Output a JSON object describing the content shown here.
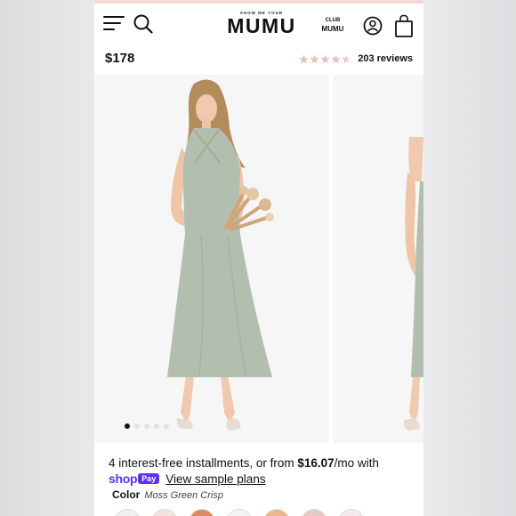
{
  "header": {
    "brand_small": "SHOW ME YOUR",
    "brand_big": "MUMU",
    "club_small": "CLUB",
    "club_big": "MUMU",
    "icons": [
      "menu-icon",
      "search-icon",
      "account-icon",
      "bag-icon"
    ]
  },
  "product": {
    "price": "$178",
    "rating": 4.5,
    "reviews": "203 reviews",
    "dress_color": "#b3bfae"
  },
  "gallery": {
    "slide_count": 5,
    "active_slide": 1
  },
  "payment": {
    "installments_prefix": "4 interest-free installments, or from ",
    "installments_amount": "$16.07",
    "installments_suffix": "/mo with",
    "shop_word": "shop",
    "pay_word": "Pay",
    "sample_link": "View sample plans",
    "brand_color": "#5a31f4"
  },
  "color": {
    "label": "Color",
    "value": "Moss Green Crisp",
    "swatches": [
      "#efefef",
      "#f0e4dc",
      "#d98b63",
      "#f4f4f4",
      "#e8b98d",
      "#e7c9c4",
      "#f3ecec"
    ]
  },
  "accent_colors": {
    "star": "#e9c2bf",
    "top_strip": "#f4d9d8"
  }
}
